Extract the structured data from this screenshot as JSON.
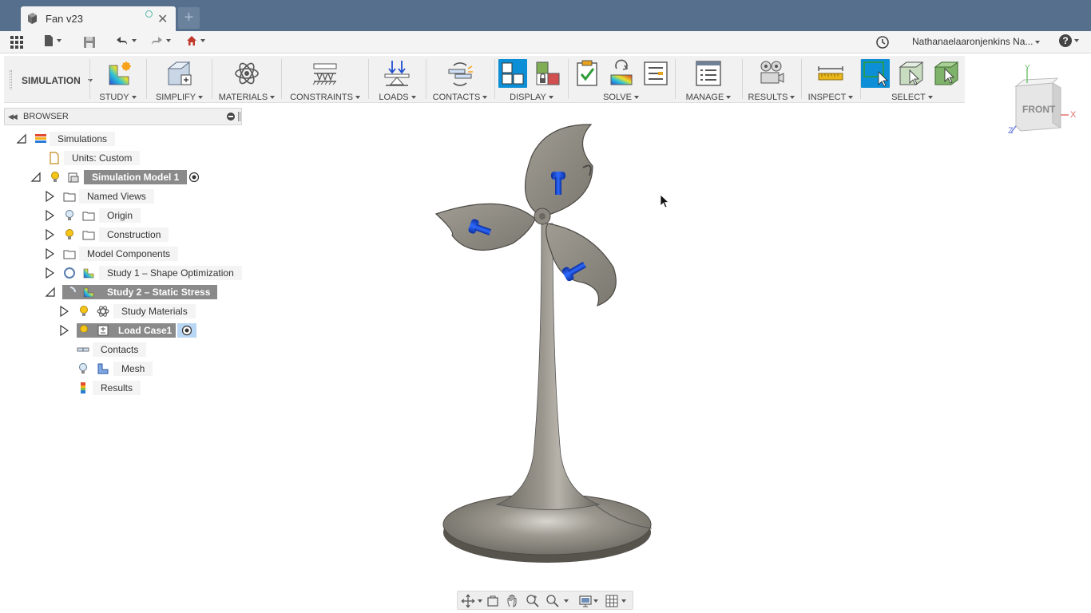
{
  "window": {
    "tab_title": "Fan v23",
    "new_tab_symbol": "+",
    "close_symbol": "✕"
  },
  "quick_access": {
    "user_name": "Nathanaelaaronjenkins Na...",
    "help_symbol": "?"
  },
  "toolbar": {
    "workspace_label": "SIMULATION",
    "groups": [
      {
        "label": "STUDY"
      },
      {
        "label": "SIMPLIFY"
      },
      {
        "label": "MATERIALS"
      },
      {
        "label": "CONSTRAINTS"
      },
      {
        "label": "LOADS"
      },
      {
        "label": "CONTACTS"
      },
      {
        "label": "DISPLAY"
      },
      {
        "label": "SOLVE"
      },
      {
        "label": "MANAGE"
      },
      {
        "label": "RESULTS"
      },
      {
        "label": "INSPECT"
      },
      {
        "label": "SELECT"
      }
    ]
  },
  "browser": {
    "title": "BROWSER",
    "tree": [
      {
        "label": "Simulations"
      },
      {
        "label": "Units: Custom"
      },
      {
        "label": "Simulation Model 1"
      },
      {
        "label": "Named Views"
      },
      {
        "label": "Origin"
      },
      {
        "label": "Construction"
      },
      {
        "label": "Model Components"
      },
      {
        "label": "Study 1 – Shape Optimization"
      },
      {
        "label": "Study 2 – Static Stress"
      },
      {
        "label": "Study Materials"
      },
      {
        "label": "Load Case1"
      },
      {
        "label": "Contacts"
      },
      {
        "label": "Mesh"
      },
      {
        "label": "Results"
      }
    ]
  },
  "viewcube": {
    "face_label": "FRONT",
    "axis_x": "X",
    "axis_y": "Y",
    "axis_z": "Z"
  },
  "colors": {
    "titlebar": "#566f8c",
    "selected": "#0c8fd6",
    "active_node": "#8a8a8a",
    "load_arrow": "#1f4fd1",
    "model_gray": "#8a867e"
  }
}
